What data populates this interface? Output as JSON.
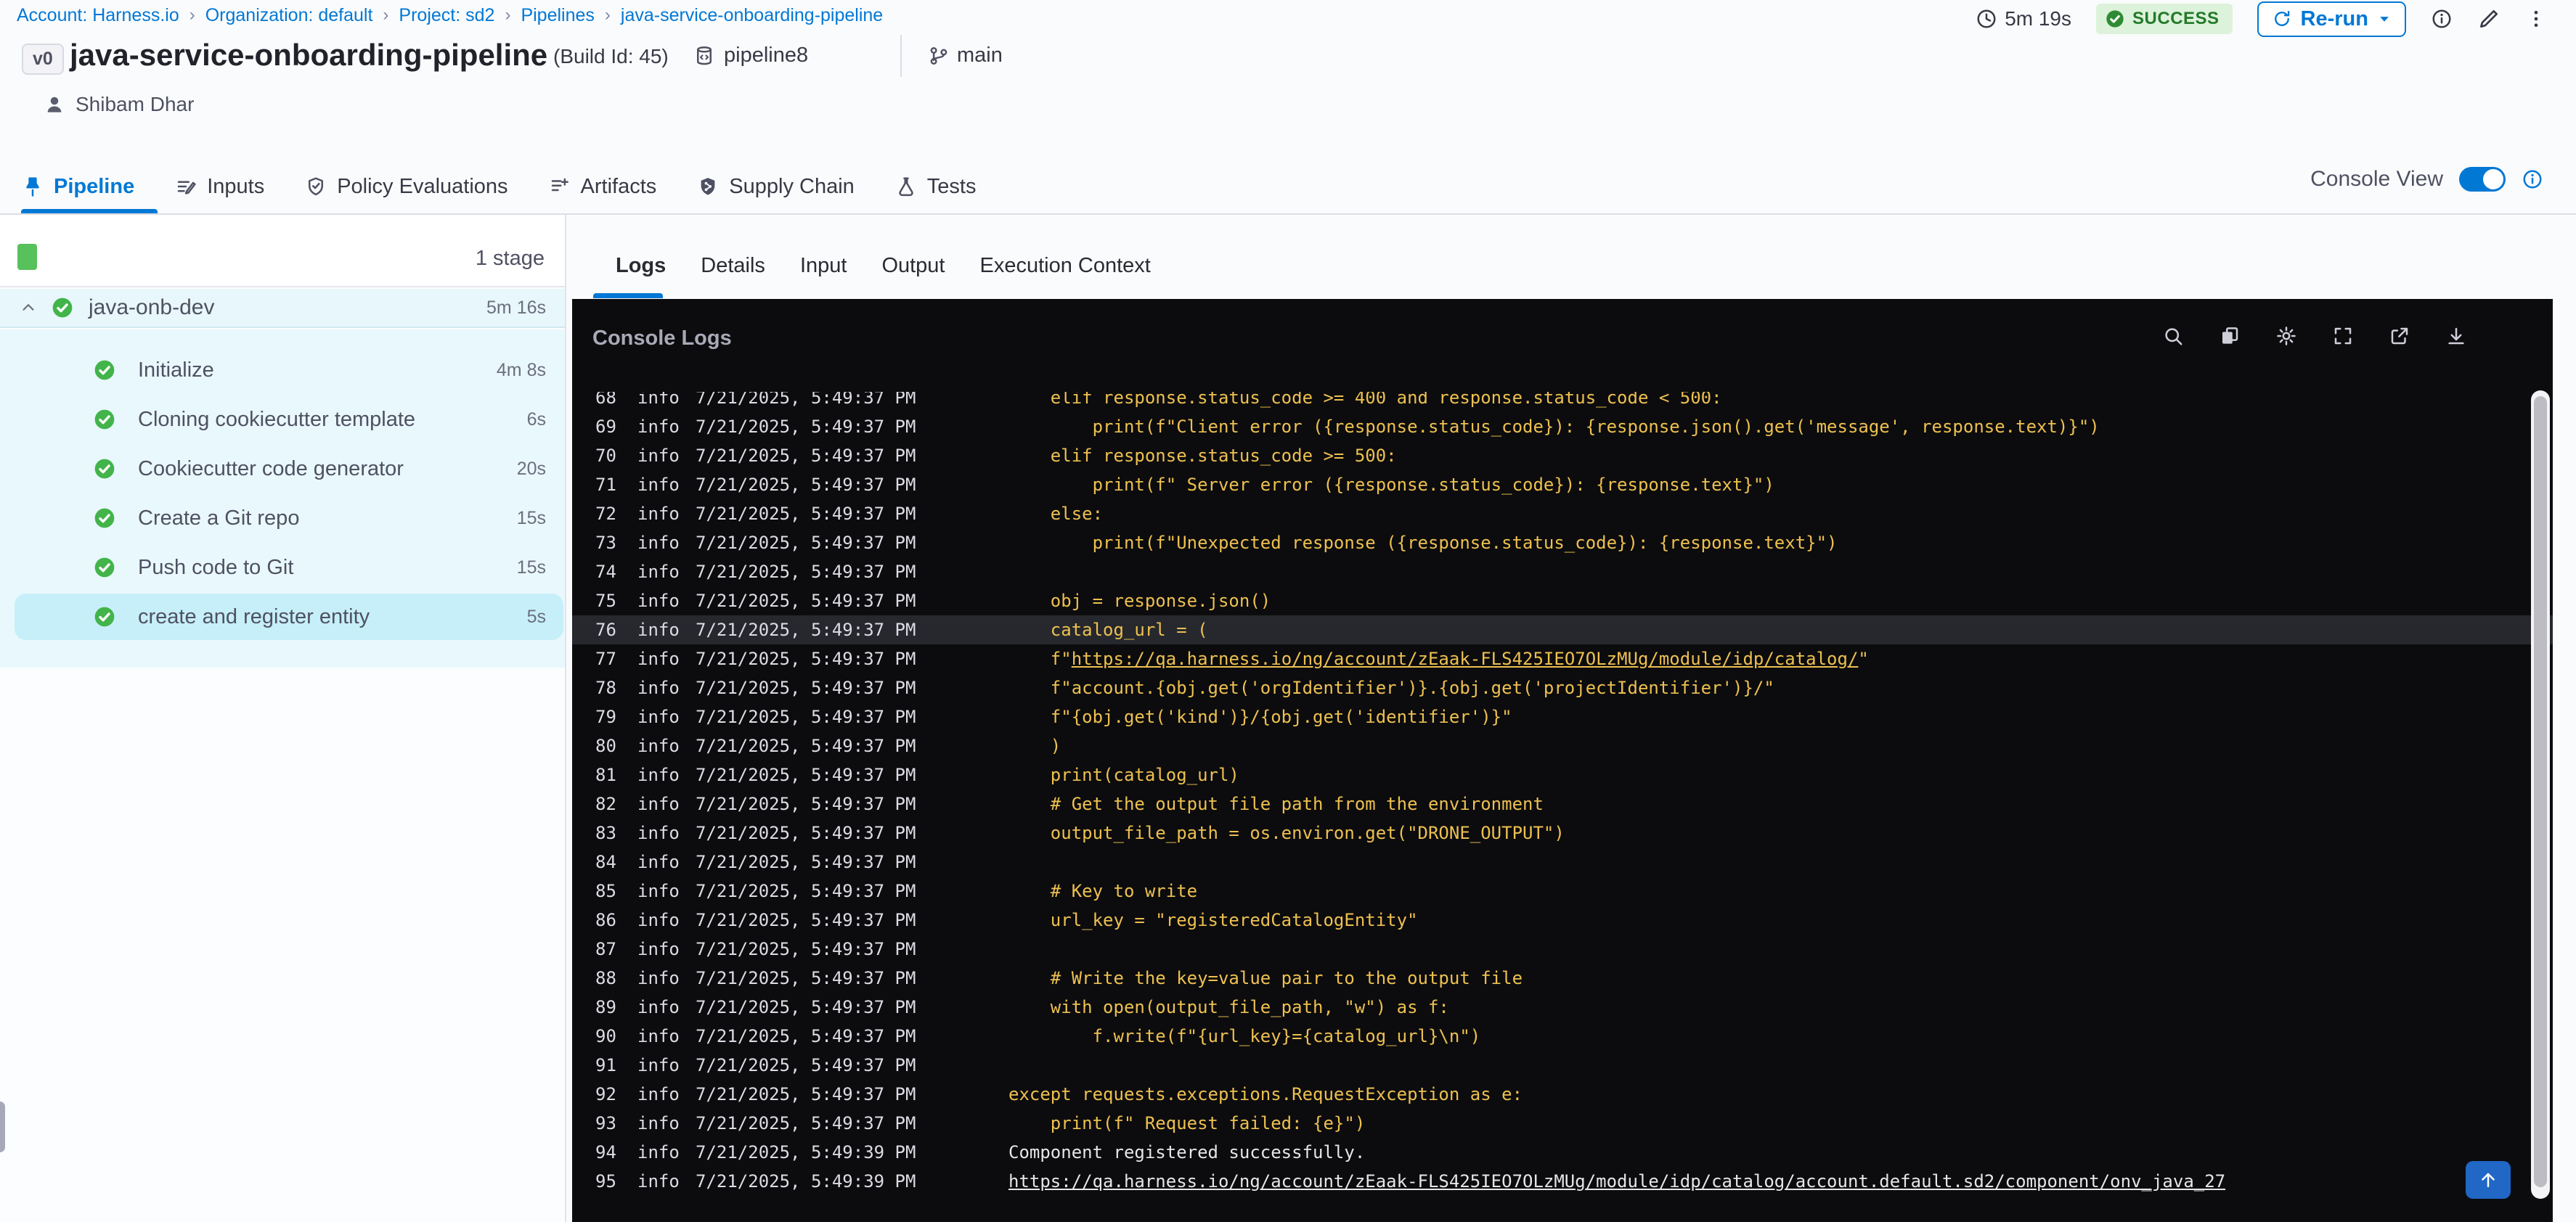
{
  "breadcrumb": {
    "items": [
      "Account: Harness.io",
      "Organization: default",
      "Project: sd2",
      "Pipelines",
      "java-service-onboarding-pipeline"
    ]
  },
  "header": {
    "version_badge": "v0",
    "title": "java-service-onboarding-pipeline",
    "build_id": "(Build Id: 45)",
    "pipeline_ref": "pipeline8",
    "branch": "main",
    "user": "Shibam Dhar",
    "duration": "5m 19s",
    "status": "SUCCESS",
    "rerun_label": "Re-run"
  },
  "main_tabs": {
    "items": [
      {
        "id": "pipeline",
        "label": "Pipeline",
        "icon": "pin-icon",
        "active": true
      },
      {
        "id": "inputs",
        "label": "Inputs",
        "icon": "inputs-icon",
        "active": false
      },
      {
        "id": "policy-evaluations",
        "label": "Policy Evaluations",
        "icon": "shield-check-icon",
        "active": false
      },
      {
        "id": "artifacts",
        "label": "Artifacts",
        "icon": "artifacts-icon",
        "active": false
      },
      {
        "id": "supply-chain",
        "label": "Supply Chain",
        "icon": "supply-chain-icon",
        "active": false
      },
      {
        "id": "tests",
        "label": "Tests",
        "icon": "flask-icon",
        "active": false
      }
    ]
  },
  "console_view": {
    "label": "Console View",
    "enabled": true
  },
  "sidebar": {
    "stage_count": "1 stage",
    "stage": {
      "name": "java-onb-dev",
      "duration": "5m 16s",
      "status": "success"
    },
    "steps": [
      {
        "label": "Initialize",
        "duration": "4m 8s",
        "status": "success",
        "selected": false
      },
      {
        "label": "Cloning cookiecutter template",
        "duration": "6s",
        "status": "success",
        "selected": false
      },
      {
        "label": "Cookiecutter code generator",
        "duration": "20s",
        "status": "success",
        "selected": false
      },
      {
        "label": "Create a Git repo",
        "duration": "15s",
        "status": "success",
        "selected": false
      },
      {
        "label": "Push code to Git",
        "duration": "15s",
        "status": "success",
        "selected": false
      },
      {
        "label": "create and register entity",
        "duration": "5s",
        "status": "success",
        "selected": true
      }
    ]
  },
  "detail_tabs": {
    "items": [
      "Logs",
      "Details",
      "Input",
      "Output",
      "Execution Context"
    ],
    "active": "Logs"
  },
  "console": {
    "title": "Console Logs",
    "header_icons": [
      "search-icon",
      "copy-icon",
      "settings-icon",
      "fullscreen-icon",
      "open-in-new-icon",
      "download-icon"
    ],
    "colors": {
      "background": "#0c0c0e",
      "code_text": "#edc050",
      "plain_text": "#e6e6ea",
      "meta_text": "#dcdce4",
      "highlight_row": "#26282d",
      "accent": "#0278d5",
      "success_green": "#42b44a",
      "selected_step_bg": "#c6eff9",
      "stage_bg": "#e7f7fb"
    },
    "logs": [
      {
        "n": 68,
        "level": "info",
        "ts": "7/21/2025, 5:49:37 PM",
        "color": "code",
        "highlight": false,
        "parts": [
          {
            "t": "    elif response.status_code >= 400 and response.status_code < 500:",
            "link": false
          }
        ]
      },
      {
        "n": 69,
        "level": "info",
        "ts": "7/21/2025, 5:49:37 PM",
        "color": "code",
        "highlight": false,
        "parts": [
          {
            "t": "        print(f\"Client error ({response.status_code}): {response.json().get('message', response.text)}\")",
            "link": false
          }
        ]
      },
      {
        "n": 70,
        "level": "info",
        "ts": "7/21/2025, 5:49:37 PM",
        "color": "code",
        "highlight": false,
        "parts": [
          {
            "t": "    elif response.status_code >= 500:",
            "link": false
          }
        ]
      },
      {
        "n": 71,
        "level": "info",
        "ts": "7/21/2025, 5:49:37 PM",
        "color": "code",
        "highlight": false,
        "parts": [
          {
            "t": "        print(f\" Server error ({response.status_code}): {response.text}\")",
            "link": false
          }
        ]
      },
      {
        "n": 72,
        "level": "info",
        "ts": "7/21/2025, 5:49:37 PM",
        "color": "code",
        "highlight": false,
        "parts": [
          {
            "t": "    else:",
            "link": false
          }
        ]
      },
      {
        "n": 73,
        "level": "info",
        "ts": "7/21/2025, 5:49:37 PM",
        "color": "code",
        "highlight": false,
        "parts": [
          {
            "t": "        print(f\"Unexpected response ({response.status_code}): {response.text}\")",
            "link": false
          }
        ]
      },
      {
        "n": 74,
        "level": "info",
        "ts": "7/21/2025, 5:49:37 PM",
        "color": "code",
        "highlight": false,
        "parts": [
          {
            "t": "",
            "link": false
          }
        ]
      },
      {
        "n": 75,
        "level": "info",
        "ts": "7/21/2025, 5:49:37 PM",
        "color": "code",
        "highlight": false,
        "parts": [
          {
            "t": "    obj = response.json()",
            "link": false
          }
        ]
      },
      {
        "n": 76,
        "level": "info",
        "ts": "7/21/2025, 5:49:37 PM",
        "color": "code",
        "highlight": true,
        "parts": [
          {
            "t": "    catalog_url = (",
            "link": false
          }
        ]
      },
      {
        "n": 77,
        "level": "info",
        "ts": "7/21/2025, 5:49:37 PM",
        "color": "code",
        "highlight": false,
        "parts": [
          {
            "t": "    f\"",
            "link": false
          },
          {
            "t": "https://qa.harness.io/ng/account/zEaak-FLS425IEO7OLzMUg/module/idp/catalog/",
            "link": true
          },
          {
            "t": "\"",
            "link": false
          }
        ]
      },
      {
        "n": 78,
        "level": "info",
        "ts": "7/21/2025, 5:49:37 PM",
        "color": "code",
        "highlight": false,
        "parts": [
          {
            "t": "    f\"account.{obj.get('orgIdentifier')}.{obj.get('projectIdentifier')}/\"",
            "link": false
          }
        ]
      },
      {
        "n": 79,
        "level": "info",
        "ts": "7/21/2025, 5:49:37 PM",
        "color": "code",
        "highlight": false,
        "parts": [
          {
            "t": "    f\"{obj.get('kind')}/{obj.get('identifier')}\"",
            "link": false
          }
        ]
      },
      {
        "n": 80,
        "level": "info",
        "ts": "7/21/2025, 5:49:37 PM",
        "color": "code",
        "highlight": false,
        "parts": [
          {
            "t": "    )",
            "link": false
          }
        ]
      },
      {
        "n": 81,
        "level": "info",
        "ts": "7/21/2025, 5:49:37 PM",
        "color": "code",
        "highlight": false,
        "parts": [
          {
            "t": "    print(catalog_url)",
            "link": false
          }
        ]
      },
      {
        "n": 82,
        "level": "info",
        "ts": "7/21/2025, 5:49:37 PM",
        "color": "code",
        "highlight": false,
        "parts": [
          {
            "t": "    # Get the output file path from the environment",
            "link": false
          }
        ]
      },
      {
        "n": 83,
        "level": "info",
        "ts": "7/21/2025, 5:49:37 PM",
        "color": "code",
        "highlight": false,
        "parts": [
          {
            "t": "    output_file_path = os.environ.get(\"DRONE_OUTPUT\")",
            "link": false
          }
        ]
      },
      {
        "n": 84,
        "level": "info",
        "ts": "7/21/2025, 5:49:37 PM",
        "color": "code",
        "highlight": false,
        "parts": [
          {
            "t": "",
            "link": false
          }
        ]
      },
      {
        "n": 85,
        "level": "info",
        "ts": "7/21/2025, 5:49:37 PM",
        "color": "code",
        "highlight": false,
        "parts": [
          {
            "t": "    # Key to write",
            "link": false
          }
        ]
      },
      {
        "n": 86,
        "level": "info",
        "ts": "7/21/2025, 5:49:37 PM",
        "color": "code",
        "highlight": false,
        "parts": [
          {
            "t": "    url_key = \"registeredCatalogEntity\"",
            "link": false
          }
        ]
      },
      {
        "n": 87,
        "level": "info",
        "ts": "7/21/2025, 5:49:37 PM",
        "color": "code",
        "highlight": false,
        "parts": [
          {
            "t": "",
            "link": false
          }
        ]
      },
      {
        "n": 88,
        "level": "info",
        "ts": "7/21/2025, 5:49:37 PM",
        "color": "code",
        "highlight": false,
        "parts": [
          {
            "t": "    # Write the key=value pair to the output file",
            "link": false
          }
        ]
      },
      {
        "n": 89,
        "level": "info",
        "ts": "7/21/2025, 5:49:37 PM",
        "color": "code",
        "highlight": false,
        "parts": [
          {
            "t": "    with open(output_file_path, \"w\") as f:",
            "link": false
          }
        ]
      },
      {
        "n": 90,
        "level": "info",
        "ts": "7/21/2025, 5:49:37 PM",
        "color": "code",
        "highlight": false,
        "parts": [
          {
            "t": "        f.write(f\"{url_key}={catalog_url}\\n\")",
            "link": false
          }
        ]
      },
      {
        "n": 91,
        "level": "info",
        "ts": "7/21/2025, 5:49:37 PM",
        "color": "code",
        "highlight": false,
        "parts": [
          {
            "t": "",
            "link": false
          }
        ]
      },
      {
        "n": 92,
        "level": "info",
        "ts": "7/21/2025, 5:49:37 PM",
        "color": "code",
        "highlight": false,
        "parts": [
          {
            "t": "except requests.exceptions.RequestException as e:",
            "link": false
          }
        ]
      },
      {
        "n": 93,
        "level": "info",
        "ts": "7/21/2025, 5:49:37 PM",
        "color": "code",
        "highlight": false,
        "parts": [
          {
            "t": "    print(f\" Request failed: {e}\")",
            "link": false
          }
        ]
      },
      {
        "n": 94,
        "level": "info",
        "ts": "7/21/2025, 5:49:39 PM",
        "color": "plain",
        "highlight": false,
        "parts": [
          {
            "t": "Component registered successfully.",
            "link": false
          }
        ]
      },
      {
        "n": 95,
        "level": "info",
        "ts": "7/21/2025, 5:49:39 PM",
        "color": "plain",
        "highlight": false,
        "parts": [
          {
            "t": "https://qa.harness.io/ng/account/zEaak-FLS425IEO7OLzMUg/module/idp/catalog/account.default.sd2/component/onv_java_27",
            "link": true
          }
        ]
      }
    ]
  }
}
